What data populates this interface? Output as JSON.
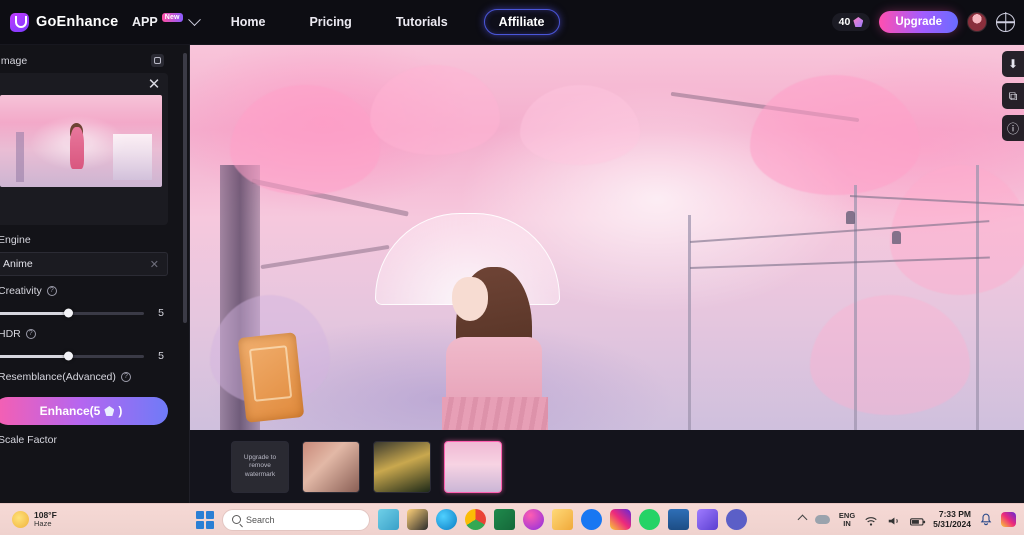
{
  "header": {
    "brand": "GoEnhance",
    "logo_icon": "goenhance-logo-icon",
    "app_menu": {
      "label": "APP",
      "badge": "New",
      "chevron_icon": "chevron-down-icon"
    },
    "nav": [
      {
        "label": "Home"
      },
      {
        "label": "Pricing"
      },
      {
        "label": "Tutorials"
      }
    ],
    "affiliate": "Affiliate",
    "credits": {
      "amount": "40",
      "icon": "gem-icon"
    },
    "upgrade": "Upgrade",
    "avatar_icon": "user-avatar",
    "language_icon": "globe-icon"
  },
  "sidebar": {
    "image_section": {
      "label": "Image",
      "icon": "image-upload-icon",
      "close_icon": "close-icon"
    },
    "engine": {
      "label": "Engine",
      "value": "Anime",
      "clear_icon": "clear-icon"
    },
    "creativity": {
      "label": "Creativity",
      "help_icon": "help-icon",
      "value": "5"
    },
    "hdr": {
      "label": "HDR",
      "help_icon": "help-icon",
      "value": "5"
    },
    "resemblance": {
      "label": "Resemblance(Advanced)",
      "help_icon": "help-icon"
    },
    "enhance_button": {
      "label": "Enhance(5",
      "suffix": ")",
      "gem_icon": "gem-icon"
    },
    "scale_factor": {
      "label": "Scale Factor"
    }
  },
  "canvas": {
    "tools": [
      {
        "name": "download-button",
        "glyph": "⬇"
      },
      {
        "name": "compare-button",
        "glyph": "⧉"
      },
      {
        "name": "info-button",
        "glyph": "ⓘ"
      }
    ],
    "filmstrip": [
      {
        "name": "thumbnail-upgrade",
        "overlay": "Upgrade to remove watermark",
        "selected": false
      },
      {
        "name": "thumbnail-2",
        "overlay": "",
        "selected": false
      },
      {
        "name": "thumbnail-3",
        "overlay": "",
        "selected": false
      },
      {
        "name": "thumbnail-4",
        "overlay": "",
        "selected": true
      }
    ]
  },
  "taskbar": {
    "weather": {
      "temp": "108°F",
      "condition": "Haze",
      "icon": "haze-icon"
    },
    "start_icon": "windows-start-icon",
    "search": {
      "placeholder": "Search",
      "icon": "search-icon"
    },
    "apps": [
      {
        "name": "widgets-icon"
      },
      {
        "name": "file-explorer-icon"
      },
      {
        "name": "microsoft-edge-icon"
      },
      {
        "name": "google-chrome-icon"
      },
      {
        "name": "microsoft-excel-icon"
      },
      {
        "name": "messenger-icon"
      },
      {
        "name": "folder-icon"
      },
      {
        "name": "facebook-icon"
      },
      {
        "name": "instagram-icon"
      },
      {
        "name": "whatsapp-icon"
      },
      {
        "name": "recycle-bin-icon"
      },
      {
        "name": "purple-app-icon"
      },
      {
        "name": "microsoft-teams-icon"
      }
    ],
    "tray": {
      "overflow_icon": "chevron-up-icon",
      "cloud_icon": "onedrive-icon",
      "language": "ENG",
      "language_sub": "IN",
      "wifi_icon": "wifi-icon",
      "volume_icon": "volume-icon",
      "battery_icon": "battery-icon",
      "time": "7:33 PM",
      "date": "5/31/2024",
      "notification_icon": "bell-icon"
    }
  }
}
